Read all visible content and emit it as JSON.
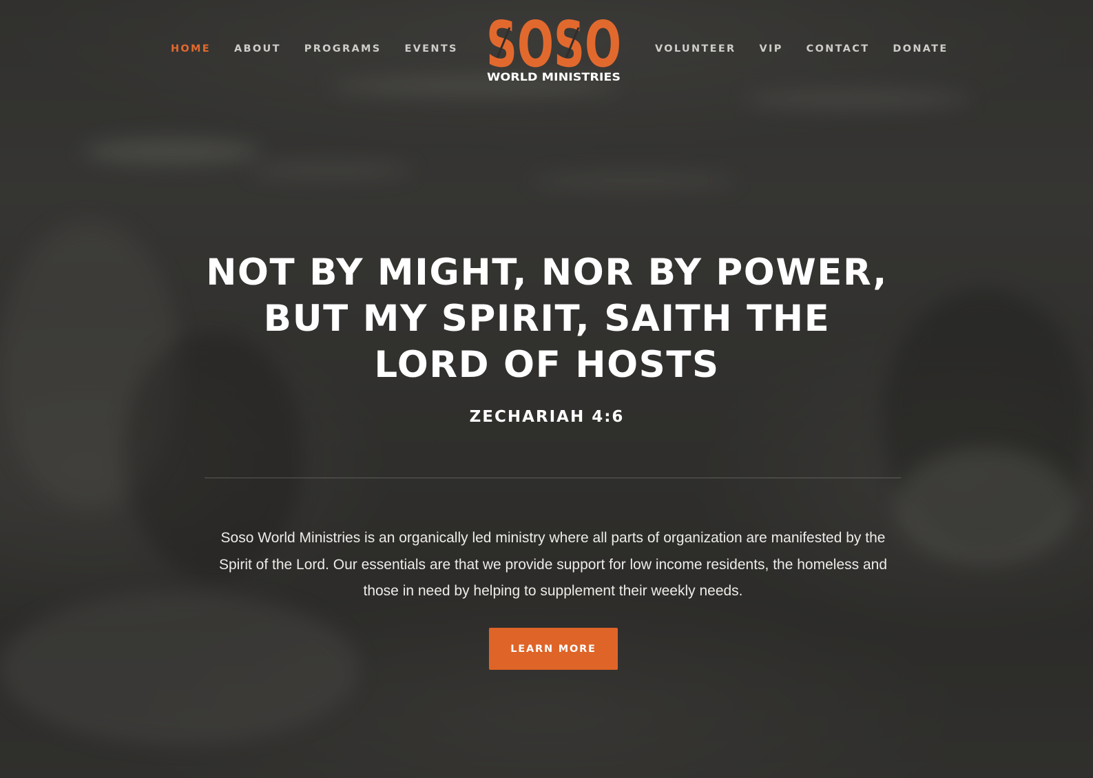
{
  "colors": {
    "accent": "#e2692d",
    "button": "#df6428",
    "text": "#ffffff",
    "nav_text": "#cfcdc9"
  },
  "nav": {
    "left": [
      {
        "label": "HOME",
        "active": true
      },
      {
        "label": "ABOUT",
        "active": false
      },
      {
        "label": "PROGRAMS",
        "active": false
      },
      {
        "label": "EVENTS",
        "active": false
      }
    ],
    "right": [
      {
        "label": "VOLUNTEER",
        "active": false
      },
      {
        "label": "VIP",
        "active": false
      },
      {
        "label": "CONTACT",
        "active": false
      },
      {
        "label": "DONATE",
        "active": false
      }
    ]
  },
  "logo": {
    "wordmark": "SOSO",
    "tagline": "WORLD MINISTRIES"
  },
  "hero": {
    "title": "NOT BY MIGHT, NOR BY POWER, BUT MY SPIRIT, SAITH THE LORD OF HOSTS",
    "reference": "ZECHARIAH 4:6",
    "description": "Soso World Ministries is an organically led ministry where all parts of organization are manifested by the Spirit of the Lord. Our essentials are that we provide support for low income residents, the homeless and those in need by helping to supplement their weekly needs.",
    "cta_label": "LEARN MORE"
  }
}
